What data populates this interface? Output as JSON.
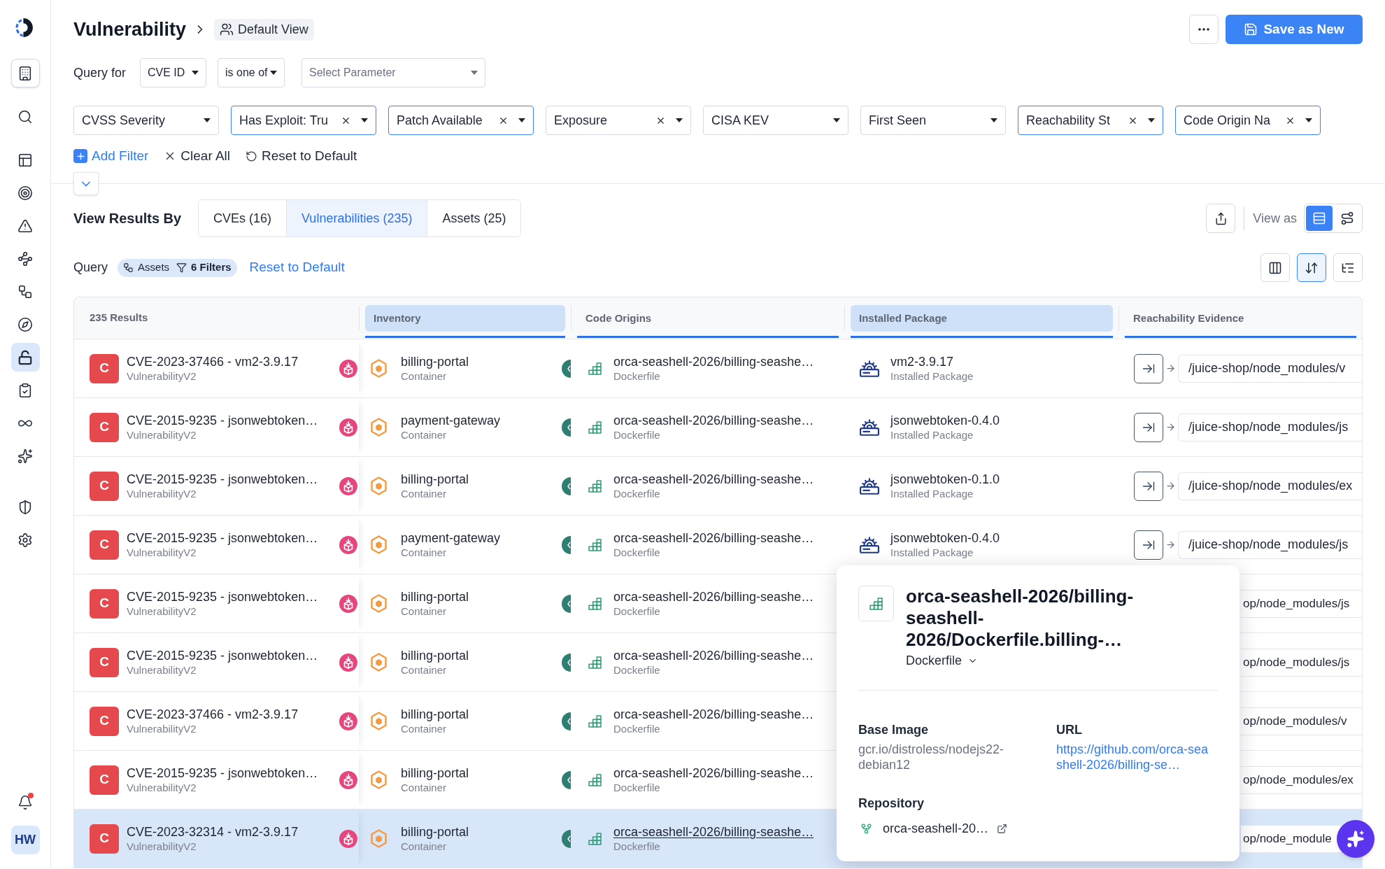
{
  "sidebar": {
    "items": [
      {
        "selected": false
      },
      {
        "selected": false
      },
      {
        "selected": false
      },
      {
        "selected": false
      },
      {
        "selected": false
      },
      {
        "selected": false
      },
      {
        "selected": false
      },
      {
        "selected": true
      },
      {
        "selected": false
      },
      {
        "selected": false
      },
      {
        "selected": false
      },
      {
        "selected": false
      },
      {
        "selected": false
      }
    ],
    "notifications": {
      "unread": true
    },
    "avatar": {
      "initials": "HW"
    }
  },
  "header": {
    "title": "Vulnerability",
    "view": "Default View",
    "primary_button": "Save as New"
  },
  "query": {
    "label": "Query for",
    "field": "CVE ID",
    "operator": "is one of",
    "parameter": {
      "placeholder": "Select Parameter"
    }
  },
  "filters": [
    {
      "label": "CVSS Severity",
      "active": false,
      "clearable": false
    },
    {
      "label": "Has Exploit: Tru",
      "active": true,
      "clearable": true
    },
    {
      "label": "Patch Available",
      "active": true,
      "clearable": true
    },
    {
      "label": "Exposure",
      "active": false,
      "clearable": true
    },
    {
      "label": "CISA KEV",
      "active": false,
      "clearable": false
    },
    {
      "label": "First Seen",
      "active": false,
      "clearable": false
    },
    {
      "label": "Reachability St",
      "active": true,
      "clearable": true
    },
    {
      "label": "Code Origin Na",
      "active": true,
      "clearable": true
    }
  ],
  "filter_actions": [
    {
      "kind": "add",
      "label": "Add Filter"
    },
    {
      "kind": "clear",
      "label": "Clear All"
    },
    {
      "kind": "reset",
      "label": "Reset to Default"
    }
  ],
  "view_results": {
    "label": "View Results By",
    "tabs": [
      {
        "label": "CVEs (16)",
        "selected": false
      },
      {
        "label": "Vulnerabilities (235)",
        "selected": true
      },
      {
        "label": "Assets (25)",
        "selected": false
      }
    ],
    "view_as_label": "View as",
    "view_modes": [
      {
        "selected": true
      },
      {
        "selected": false
      }
    ]
  },
  "query_summary": {
    "label": "Query",
    "asset": "Assets",
    "filters": "6 Filters",
    "reset_link": "Reset to Default"
  },
  "table_tools": [
    {
      "selected": false
    },
    {
      "selected": true
    },
    {
      "selected": false
    }
  ],
  "table": {
    "count": "235 Results",
    "columns": [
      {
        "label": "Inventory",
        "highlighted": true
      },
      {
        "label": "Code Origins",
        "highlighted": false
      },
      {
        "label": "Installed Package",
        "highlighted": true
      },
      {
        "label": "Reachability Evidence",
        "highlighted": false
      }
    ],
    "rows": [
      {
        "selected": false,
        "severity": "C",
        "title": "CVE-2023-37466 - vm2-3.9.17",
        "type": "VulnerabilityV2",
        "inventory": {
          "name": "billing-portal",
          "type": "Container"
        },
        "code_origin": {
          "name": "orca-seashell-2026/billing-seashe…",
          "type": "Dockerfile",
          "hovered": false
        },
        "package": {
          "name": "vm2-3.9.17",
          "type": "Installed Package"
        },
        "reachability": {
          "kind": "full",
          "path": "/juice-shop/node_modules/v"
        }
      },
      {
        "selected": false,
        "severity": "C",
        "title": "CVE-2015-9235 - jsonwebtoken…",
        "type": "VulnerabilityV2",
        "inventory": {
          "name": "payment-gateway",
          "type": "Container"
        },
        "code_origin": {
          "name": "orca-seashell-2026/billing-seashe…",
          "type": "Dockerfile",
          "hovered": false
        },
        "package": {
          "name": "jsonwebtoken-0.4.0",
          "type": "Installed Package"
        },
        "reachability": {
          "kind": "full",
          "path": "/juice-shop/node_modules/js"
        }
      },
      {
        "selected": false,
        "severity": "C",
        "title": "CVE-2015-9235 - jsonwebtoken…",
        "type": "VulnerabilityV2",
        "inventory": {
          "name": "billing-portal",
          "type": "Container"
        },
        "code_origin": {
          "name": "orca-seashell-2026/billing-seashe…",
          "type": "Dockerfile",
          "hovered": false
        },
        "package": {
          "name": "jsonwebtoken-0.1.0",
          "type": "Installed Package"
        },
        "reachability": {
          "kind": "full",
          "path": "/juice-shop/node_modules/ex"
        }
      },
      {
        "selected": false,
        "severity": "C",
        "title": "CVE-2015-9235 - jsonwebtoken…",
        "type": "VulnerabilityV2",
        "inventory": {
          "name": "payment-gateway",
          "type": "Container"
        },
        "code_origin": {
          "name": "orca-seashell-2026/billing-seashe…",
          "type": "Dockerfile",
          "hovered": false
        },
        "package": {
          "name": "jsonwebtoken-0.4.0",
          "type": "Installed Package"
        },
        "reachability": {
          "kind": "full",
          "path": "/juice-shop/node_modules/js"
        }
      },
      {
        "selected": false,
        "severity": "C",
        "title": "CVE-2015-9235 - jsonwebtoken…",
        "type": "VulnerabilityV2",
        "inventory": {
          "name": "billing-portal",
          "type": "Container"
        },
        "code_origin": {
          "name": "orca-seashell-2026/billing-seashe…",
          "type": "Dockerfile",
          "hovered": false
        },
        "reachability": {
          "kind": "clipped",
          "path": "op/node_modules/js"
        }
      },
      {
        "selected": false,
        "severity": "C",
        "title": "CVE-2015-9235 - jsonwebtoken…",
        "type": "VulnerabilityV2",
        "inventory": {
          "name": "billing-portal",
          "type": "Container"
        },
        "code_origin": {
          "name": "orca-seashell-2026/billing-seashe…",
          "type": "Dockerfile",
          "hovered": false
        },
        "reachability": {
          "kind": "clipped",
          "path": "op/node_modules/js"
        }
      },
      {
        "selected": false,
        "severity": "C",
        "title": "CVE-2023-37466 - vm2-3.9.17",
        "type": "VulnerabilityV2",
        "inventory": {
          "name": "billing-portal",
          "type": "Container"
        },
        "code_origin": {
          "name": "orca-seashell-2026/billing-seashe…",
          "type": "Dockerfile",
          "hovered": false
        },
        "reachability": {
          "kind": "clipped",
          "path": "op/node_modules/v"
        }
      },
      {
        "selected": false,
        "severity": "C",
        "title": "CVE-2015-9235 - jsonwebtoken…",
        "type": "VulnerabilityV2",
        "inventory": {
          "name": "billing-portal",
          "type": "Container"
        },
        "code_origin": {
          "name": "orca-seashell-2026/billing-seashe…",
          "type": "Dockerfile",
          "hovered": false
        },
        "reachability": {
          "kind": "clipped",
          "path": "op/node_modules/ex"
        }
      },
      {
        "selected": true,
        "severity": "C",
        "title": "CVE-2023-32314 - vm2-3.9.17",
        "type": "VulnerabilityV2",
        "inventory": {
          "name": "billing-portal",
          "type": "Container"
        },
        "code_origin": {
          "name": "orca-seashell-2026/billing-seashe…",
          "type": "Dockerfile",
          "hovered": true
        },
        "reachability": {
          "kind": "clipped",
          "path": "op/node_module"
        }
      }
    ]
  },
  "popover": {
    "title": "orca-seashell-2026/billing-seashell-2026/Dockerfile.billing-…",
    "file_type": "Dockerfile",
    "fields": [
      {
        "kind": "text",
        "label": "Base Image",
        "value": "gcr.io/distroless/nodejs22-debian12"
      },
      {
        "kind": "link",
        "label": "URL",
        "value": "https://github.com/orca-seashell-2026/billing-se…"
      }
    ],
    "repository": {
      "label": "Repository",
      "value": "orca-seashell-20…"
    }
  }
}
